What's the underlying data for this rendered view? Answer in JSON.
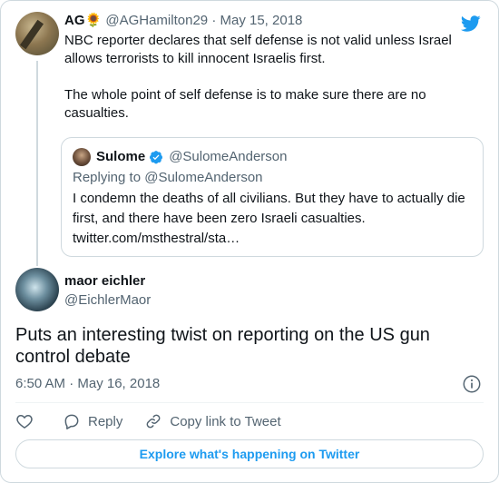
{
  "parent_tweet": {
    "name": "AG",
    "name_emoji": "🌻",
    "handle": "@AGHamilton29",
    "separator": "·",
    "date": "May 15, 2018",
    "text": "NBC reporter declares that self defense is not valid unless Israel allows terrorists to kill innocent Israelis first.\n\nThe whole point of self defense is to make sure there are no casualties."
  },
  "quoted_tweet": {
    "name": "Sulome",
    "handle": "@SulomeAnderson",
    "replying_to": "Replying to @SulomeAnderson",
    "text": "I condemn the deaths of all civilians. But they have to actually die first, and there have been zero Israeli casualties.\ntwitter.com/msthestral/sta…"
  },
  "main_tweet": {
    "name": "maor eichler",
    "handle": "@EichlerMaor",
    "text": "Puts an interesting twist on reporting on the US gun control debate",
    "timestamp": "6:50 AM · May 16, 2018"
  },
  "actions": {
    "reply_label": "Reply",
    "copy_link_label": "Copy link to Tweet"
  },
  "explore_button": "Explore what's happening on Twitter",
  "icons": {
    "brand": "twitter-bird-icon",
    "verified": "verified-badge-icon",
    "info": "info-icon",
    "like": "heart-icon",
    "reply": "speech-bubble-icon",
    "copy_link": "link-icon"
  },
  "colors": {
    "brand_blue": "#1d9bf0",
    "text_primary": "#0f1419",
    "text_secondary": "#536471",
    "border": "#cfd9de"
  }
}
